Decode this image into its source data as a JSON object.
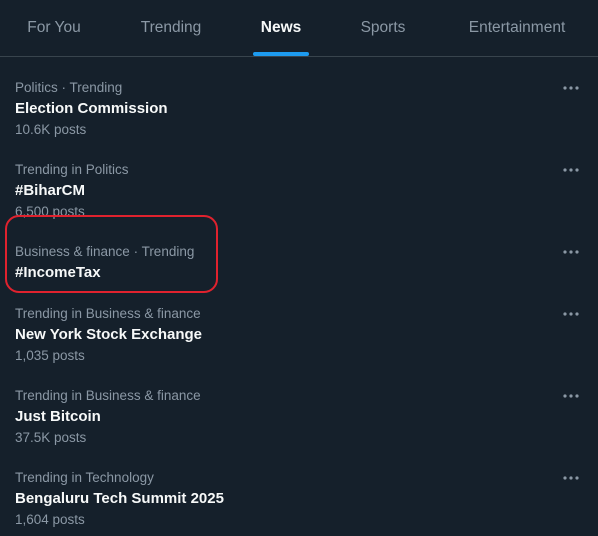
{
  "tabs": [
    {
      "label": "For You"
    },
    {
      "label": "Trending"
    },
    {
      "label": "News",
      "active": true
    },
    {
      "label": "Sports"
    },
    {
      "label": "Entertainment"
    }
  ],
  "trends": [
    {
      "context": "Politics · Trending",
      "title": "Election Commission",
      "count": "10.6K posts"
    },
    {
      "context": "Trending in Politics",
      "title": "#BiharCM",
      "count": "6,500 posts"
    },
    {
      "context": "Business & finance · Trending",
      "title": "#IncomeTax",
      "count": ""
    },
    {
      "context": "Trending in Business & finance",
      "title": "New York Stock Exchange",
      "count": "1,035 posts"
    },
    {
      "context": "Trending in Business & finance",
      "title": "Just Bitcoin",
      "count": "37.5K posts"
    },
    {
      "context": "Trending in Technology",
      "title": "Bengaluru Tech Summit 2025",
      "count": "1,604 posts"
    }
  ],
  "icons": {
    "more": "more-horizontal-icon"
  },
  "colors": {
    "background": "#15202b",
    "accent": "#1d9bf0",
    "highlight": "#e0222e",
    "secondary_text": "#8b98a5",
    "primary_text": "#f7f9f9"
  }
}
